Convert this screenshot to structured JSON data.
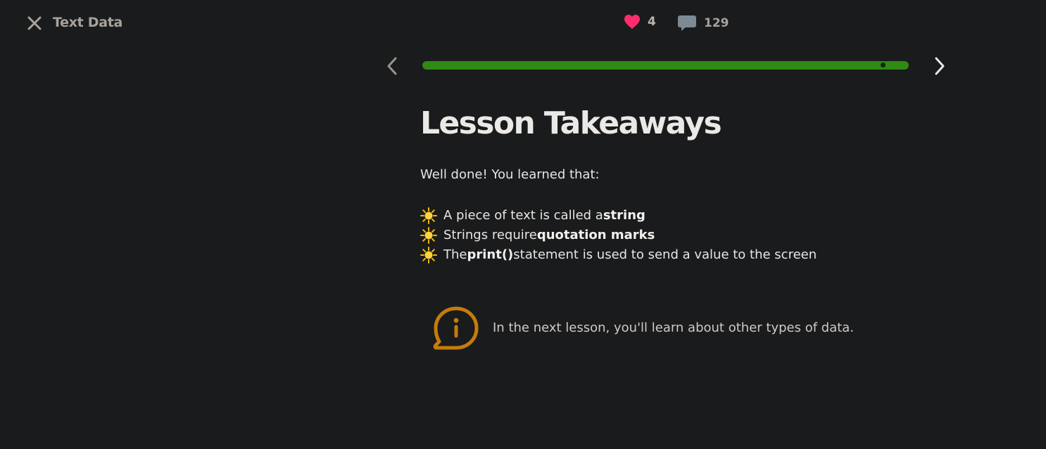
{
  "header": {
    "lesson_title": "Text Data",
    "likes_count": "4",
    "comments_count": "129"
  },
  "progress": {
    "percent": 100
  },
  "content": {
    "heading": "Lesson Takeaways",
    "intro": "Well done! You learned that:",
    "takeaways": [
      {
        "before": "A piece of text is called a ",
        "bold": "string",
        "after": ""
      },
      {
        "before": "Strings require ",
        "bold": "quotation marks",
        "after": ""
      },
      {
        "before": "The ",
        "bold": "print()",
        "after": " statement is used to send a value to the screen"
      }
    ],
    "info": "In the next lesson, you'll learn about other types of data."
  },
  "colors": {
    "background": "#1a1b1d",
    "progress": "#2f8a13",
    "heart": "#ff2d6f",
    "info_icon": "#c67c0a"
  },
  "icons": {
    "close": "close-icon",
    "heart": "heart-icon",
    "comment": "comment-icon",
    "prev": "chevron-left-icon",
    "next": "chevron-right-icon",
    "bullet": "sun-icon",
    "info": "info-bubble-icon"
  }
}
